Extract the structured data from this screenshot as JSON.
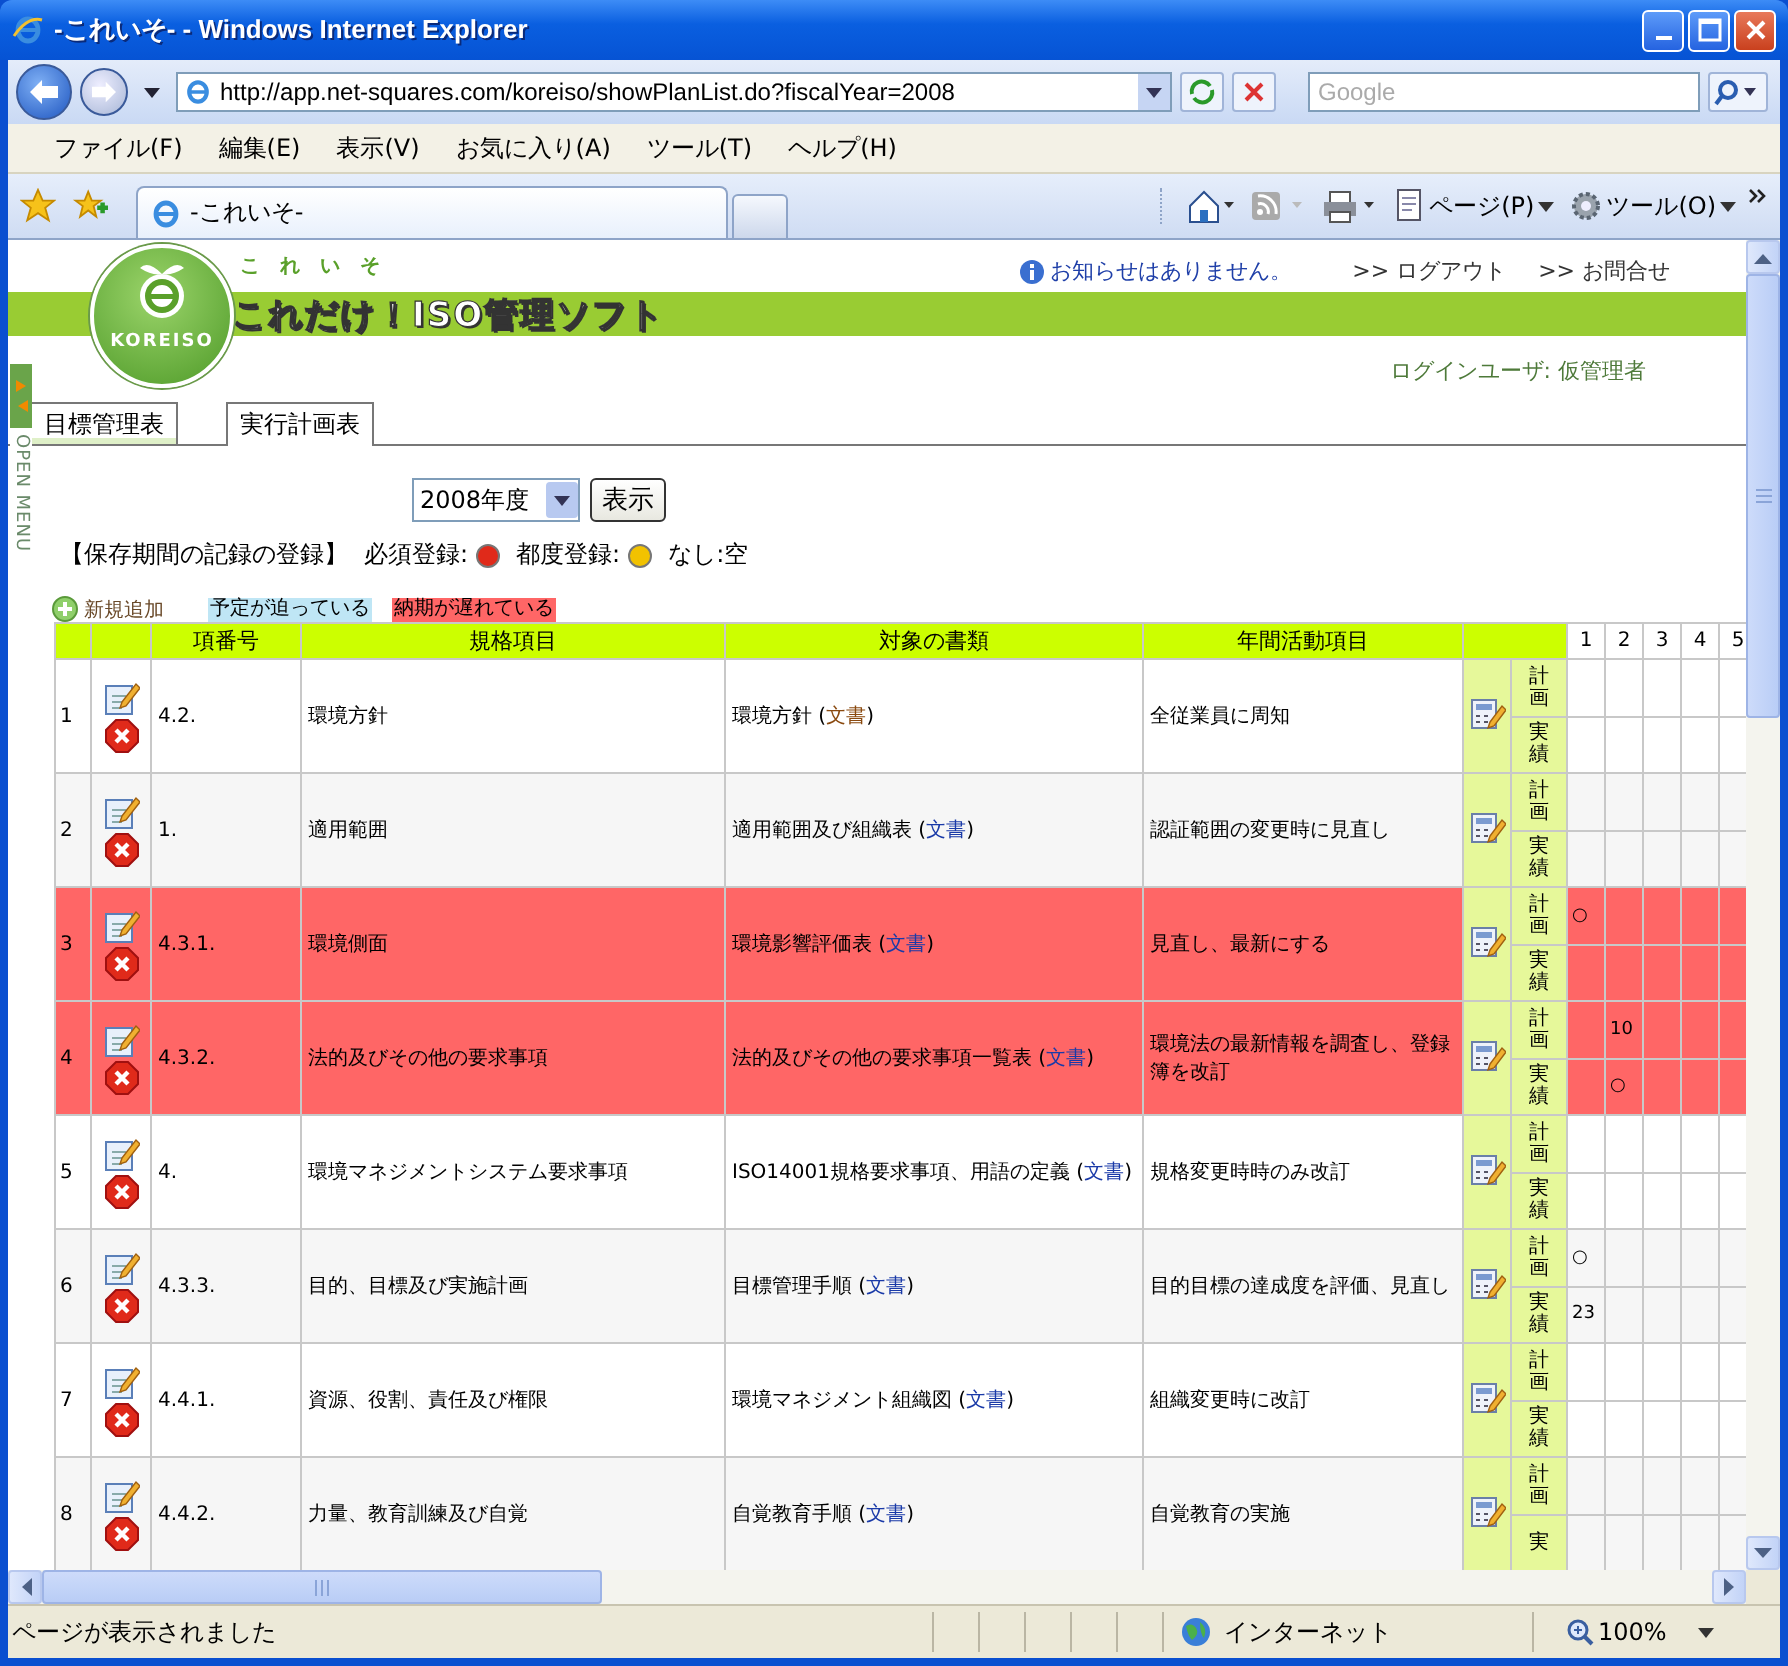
{
  "window": {
    "title": "-これいそ- - Windows Internet Explorer"
  },
  "address_bar": {
    "url": "http://app.net-squares.com/koreiso/showPlanList.do?fiscalYear=2008"
  },
  "search": {
    "placeholder": "Google"
  },
  "menu": [
    "ファイル(F)",
    "編集(E)",
    "表示(V)",
    "お気に入り(A)",
    "ツール(T)",
    "ヘルプ(H)"
  ],
  "browser_tabs": [
    {
      "label": "-これいそ-",
      "selected": true
    }
  ],
  "command_bar": [
    {
      "kind": "home"
    },
    {
      "kind": "feed"
    },
    {
      "kind": "print"
    },
    {
      "kind": "page",
      "label": "ページ(P)"
    },
    {
      "kind": "tools",
      "label": "ツール(O)"
    }
  ],
  "header": {
    "logo_kana": "これいそ",
    "logo_badge": "KOREISO",
    "logo_title": "これだけ！ISO管理ソフト",
    "notice": "お知らせはありません。",
    "links": [
      ">> ログアウト",
      ">> お問合せ"
    ],
    "login_user": "ログインユーザ:  仮管理者"
  },
  "side_menu": {
    "label": "OPEN MENU"
  },
  "page_tabs": [
    {
      "label": "目標管理表",
      "selected": false
    },
    {
      "label": "実行計画表",
      "selected": true
    }
  ],
  "year_select": {
    "value": "2008年度"
  },
  "show_button": "表示",
  "legend": {
    "title": "【保存期間の記録の登録】",
    "items": [
      {
        "kind": "dot",
        "label": "必須登録:",
        "color": "#e02a1a"
      },
      {
        "kind": "dot",
        "label": "都度登録:",
        "color": "#f2c200"
      },
      {
        "kind": "text",
        "label": "なし:空"
      }
    ]
  },
  "add_new": "新規追加",
  "status_legend": [
    {
      "label": "予定が迫っている",
      "color": "#bfe6f5"
    },
    {
      "label": "納期が遅れている",
      "color": "#ff6666"
    }
  ],
  "table": {
    "columns": [
      "項番号",
      "規格項目",
      "対象の書類",
      "年間活動項目"
    ],
    "months": [
      "1",
      "2",
      "3",
      "4",
      "5"
    ],
    "rows": [
      {
        "no": "1",
        "item_no": "4.2.",
        "standard_item": "環境方針",
        "document": {
          "before": "環境方針 (",
          "link": "文書",
          "after": ")",
          "visited": true
        },
        "activity": "全従業員に周知",
        "late": false,
        "plan_label": "計画",
        "actual_label": "実績"
      },
      {
        "no": "2",
        "item_no": "1.",
        "standard_item": "適用範囲",
        "document": {
          "before": "適用範囲及び組織表 (",
          "link": "文書",
          "after": ")",
          "visited": false
        },
        "activity": "認証範囲の変更時に見直し",
        "late": false,
        "plan_label": "計画",
        "actual_label": "実績"
      },
      {
        "no": "3",
        "item_no": "4.3.1.",
        "standard_item": "環境側面",
        "document": {
          "before": "環境影響評価表 (",
          "link": "文書",
          "after": ")",
          "visited": false
        },
        "activity": "見直し、最新にする",
        "late": true,
        "plan_label": "計画",
        "actual_label": "実績",
        "plan": {
          "month_1": "○"
        }
      },
      {
        "no": "4",
        "item_no": "4.3.2.",
        "standard_item": "法的及びその他の要求事項",
        "document": {
          "before": "法的及びその他の要求事項一覧表 (",
          "link": "文書",
          "after": ")",
          "visited": false
        },
        "activity": "環境法の最新情報を調査し、登録簿を改訂",
        "late": true,
        "plan_label": "計画",
        "actual_label": "実績",
        "plan": {
          "month_2": "10"
        },
        "actual": {
          "month_2": "○"
        }
      },
      {
        "no": "5",
        "item_no": "4.",
        "standard_item": "環境マネジメントシステム要求事項",
        "document": {
          "before": "ISO14001規格要求事項、用語の定義 (",
          "link": "文書",
          "after": ")",
          "visited": false
        },
        "activity": "規格変更時時のみ改訂",
        "late": false,
        "plan_label": "計画",
        "actual_label": "実績"
      },
      {
        "no": "6",
        "item_no": "4.3.3.",
        "standard_item": "目的、目標及び実施計画",
        "document": {
          "before": "目標管理手順 (",
          "link": "文書",
          "after": ")",
          "visited": false
        },
        "activity": "目的目標の達成度を評価、見直し",
        "late": false,
        "plan_label": "計画",
        "actual_label": "実績",
        "plan": {
          "month_1": "○"
        },
        "actual": {
          "month_1": "23"
        }
      },
      {
        "no": "7",
        "item_no": "4.4.1.",
        "standard_item": "資源、役割、責任及び権限",
        "document": {
          "before": "環境マネジメント組織図 (",
          "link": "文書",
          "after": ")",
          "visited": false
        },
        "activity": "組織変更時に改訂",
        "late": false,
        "plan_label": "計画",
        "actual_label": "実績"
      },
      {
        "no": "8",
        "item_no": "4.4.2.",
        "standard_item": "力量、教育訓練及び自覚",
        "document": {
          "before": "自覚教育手順 (",
          "link": "文書",
          "after": ")",
          "visited": false
        },
        "activity": "自覚教育の実施",
        "late": false,
        "plan_label": "計画",
        "actual_label": "実"
      }
    ]
  },
  "status_bar": {
    "text": "ページが表示されました",
    "zone": "インターネット",
    "zoom": "100%"
  }
}
